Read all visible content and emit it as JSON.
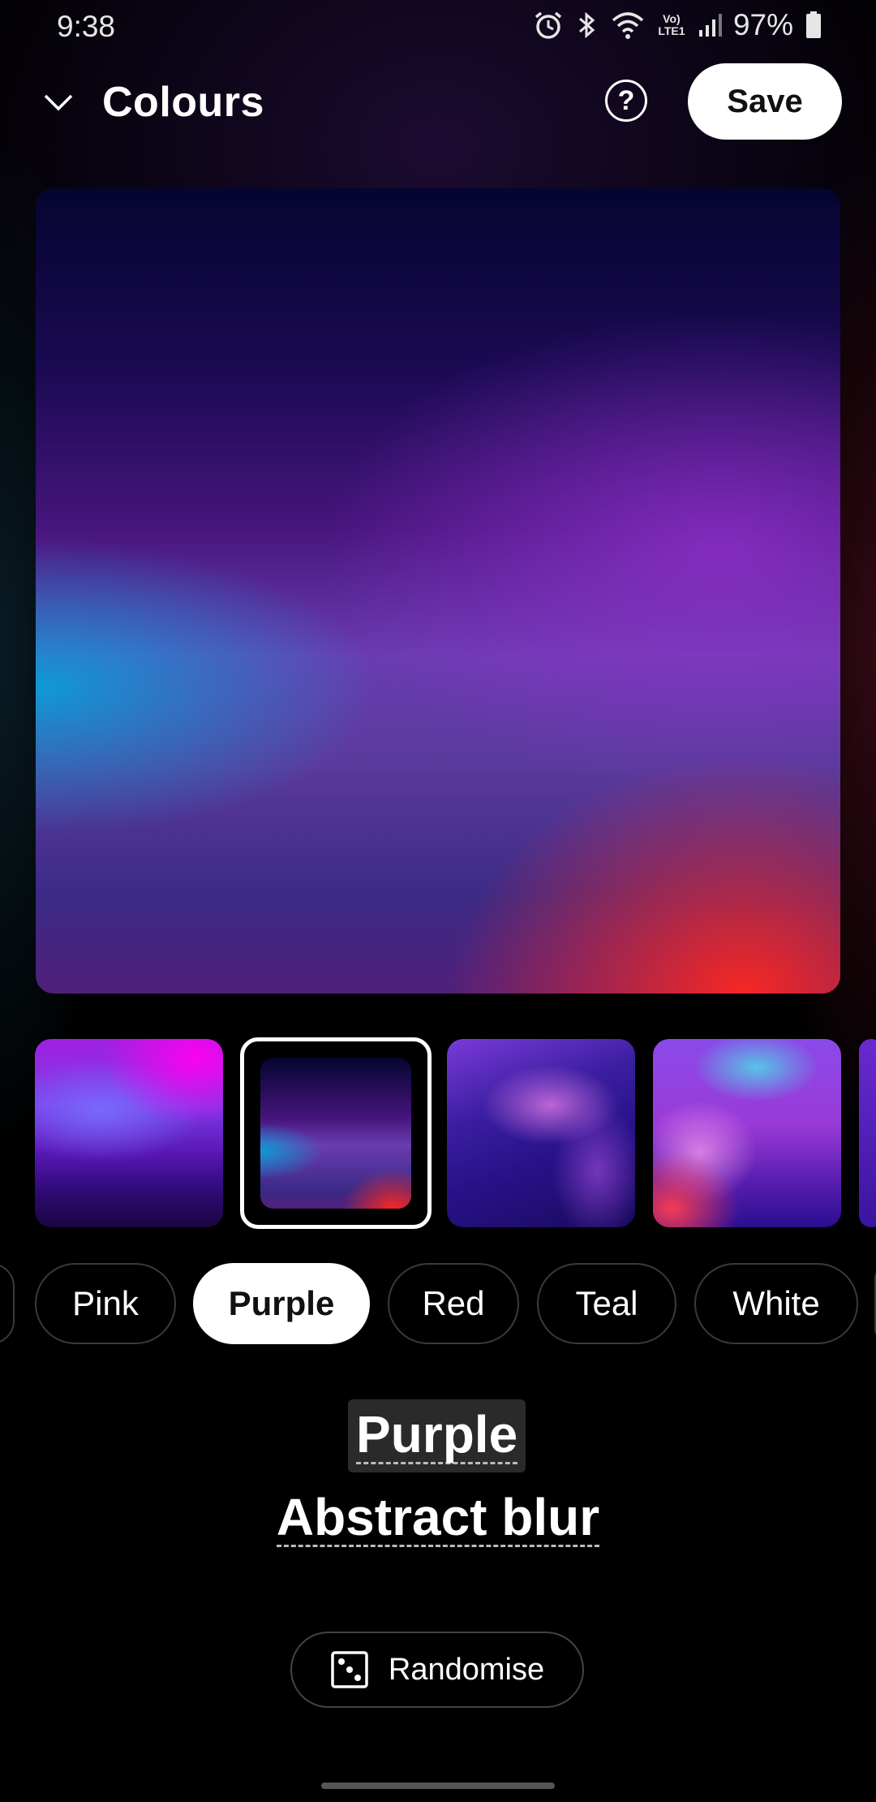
{
  "status_bar": {
    "time": "9:38",
    "battery_percent": "97%",
    "network_label": "Vo) LTE1",
    "icons": [
      "alarm-icon",
      "bluetooth-icon",
      "wifi-icon",
      "signal-icon",
      "battery-icon"
    ]
  },
  "header": {
    "title": "Colours",
    "help_label": "?",
    "save_label": "Save"
  },
  "thumbnails": {
    "selected_index": 1,
    "count_visible": 5
  },
  "chips": {
    "items": [
      "Pink",
      "Purple",
      "Red",
      "Teal",
      "White"
    ],
    "selected": "Purple"
  },
  "wallpaper": {
    "color_name": "Purple",
    "style_name": "Abstract blur"
  },
  "actions": {
    "randomise_label": "Randomise"
  }
}
